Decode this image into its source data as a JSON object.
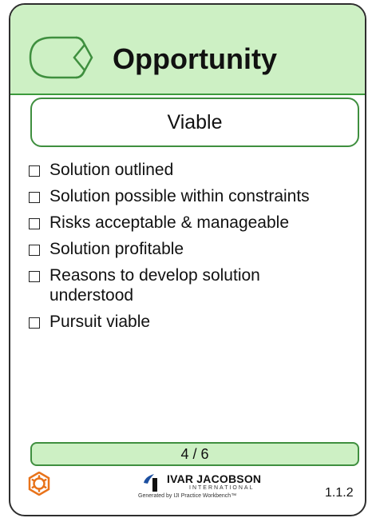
{
  "card": {
    "title": "Opportunity",
    "state": "Viable",
    "checklist": [
      "Solution outlined",
      "Solution possible within constraints",
      "Risks acceptable & manageable",
      "Solution profitable",
      "Reasons to develop solution understood",
      "Pursuit viable"
    ],
    "pager": "4 / 6",
    "version": "1.1.2"
  },
  "footer": {
    "logo_name": "IVAR JACOBSON",
    "logo_sub": "INTERNATIONAL",
    "generated_by": "Generated by IJI Practice Workbench™"
  },
  "icons": {
    "alpha": "alpha-icon",
    "gear": "gear-icon",
    "logo": "ivar-jacobson-logo-icon"
  },
  "colors": {
    "header_bg": "#cdf0c4",
    "accent_green": "#3f8f3f",
    "gear_orange": "#e8731a",
    "logo_blue": "#1c4fa0"
  }
}
